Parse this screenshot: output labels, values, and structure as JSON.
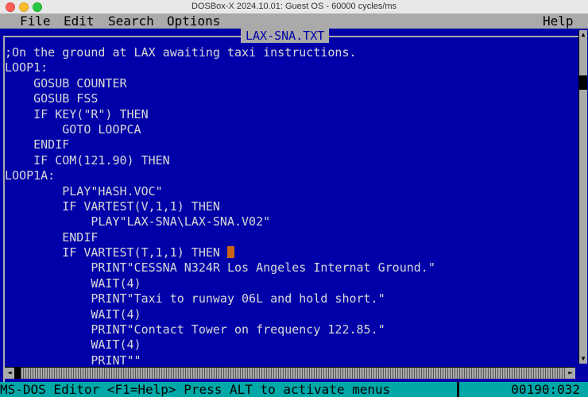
{
  "window": {
    "title": "DOSBox-X 2024.10.01: Guest OS - 60000 cycles/ms"
  },
  "menu": {
    "file": "File",
    "edit": "Edit",
    "search": "Search",
    "options": "Options",
    "help": "Help"
  },
  "editor": {
    "filename": "LAX-SNA.TXT",
    "lines": [
      ";On the ground at LAX awaiting taxi instructions.",
      "LOOP1:",
      "    GOSUB COUNTER",
      "    GOSUB FSS",
      "    IF KEY(\"R\") THEN",
      "        GOTO LOOPCA",
      "    ENDIF",
      "    IF COM(121.90) THEN",
      "LOOP1A:",
      "        PLAY\"HASH.VOC\"",
      "        IF VARTEST(V,1,1) THEN",
      "            PLAY\"LAX-SNA\\LAX-SNA.V02\"",
      "        ENDIF",
      "        IF VARTEST(T,1,1) THEN ",
      "            PRINT\"CESSNA N324R Los Angeles Internat Ground.\"",
      "            WAIT(4)",
      "            PRINT\"Taxi to runway 06L and hold short.\"",
      "            WAIT(4)",
      "            PRINT\"Contact Tower on frequency 122.85.\"",
      "            WAIT(4)",
      "            PRINT\"\""
    ]
  },
  "status": {
    "text": "MS-DOS Editor  <F1=Help> Press ALT to activate menus",
    "position": "00190:032"
  }
}
